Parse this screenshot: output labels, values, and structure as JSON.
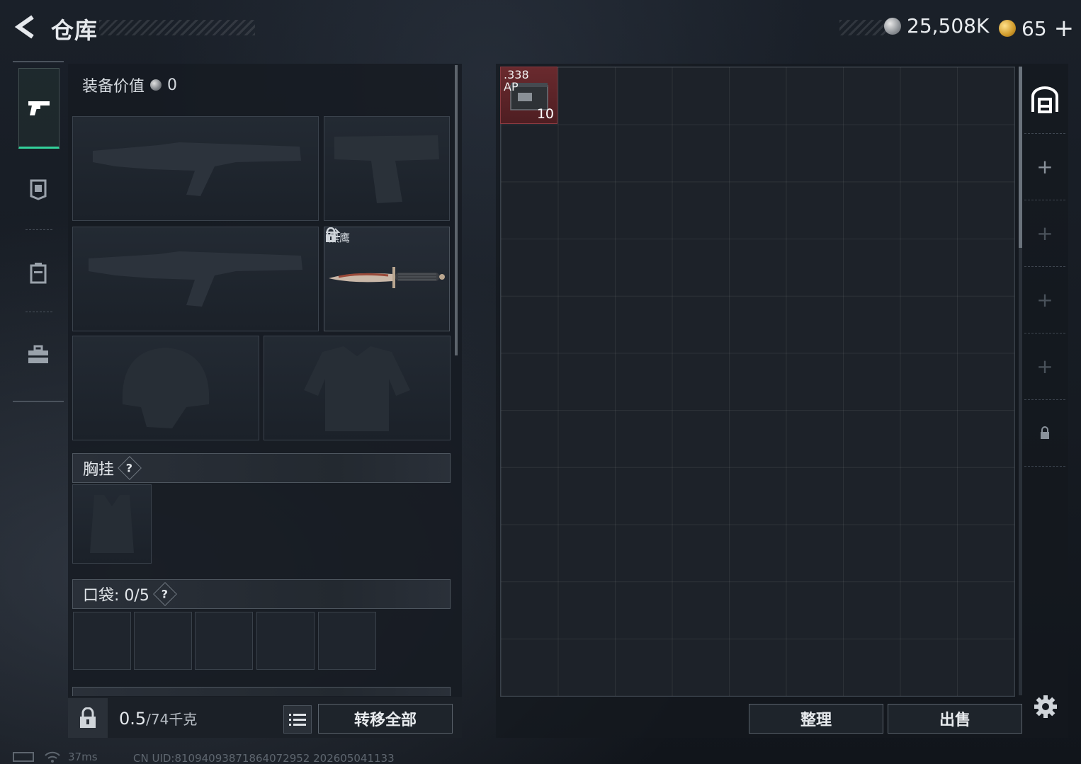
{
  "header": {
    "title": "仓库",
    "currency_primary": "25,508K",
    "currency_secondary": "65",
    "currency_plus": "+"
  },
  "equipment": {
    "value_label": "装备价值",
    "value": "0",
    "knife_name": "黑鹰",
    "chest_rig_label": "胸挂",
    "pocket_label": "口袋:",
    "pocket_count": "0/5",
    "help": "?"
  },
  "inventory": {
    "weight_current": "0.5",
    "weight_max": "/74千克",
    "transfer_all": "转移全部"
  },
  "stash": {
    "item": {
      "name": ".338\nAP",
      "name_line1": ".338",
      "name_line2": "AP",
      "quantity": "10",
      "color": "#6a2a2e"
    },
    "sort_button": "整理",
    "sell_button": "出售"
  },
  "status": {
    "ping": "37ms",
    "uid": "CN UID:8109409387186407295​2 202605041133"
  },
  "colors": {
    "accent": "#33d19a"
  },
  "icons": [
    "back-arrow-icon",
    "pistol-icon",
    "helmet-icon",
    "backpack-icon",
    "toolbox-icon",
    "lock-icon",
    "list-icon",
    "storage-icon",
    "gear-icon",
    "swap-icon",
    "wifi-icon"
  ]
}
